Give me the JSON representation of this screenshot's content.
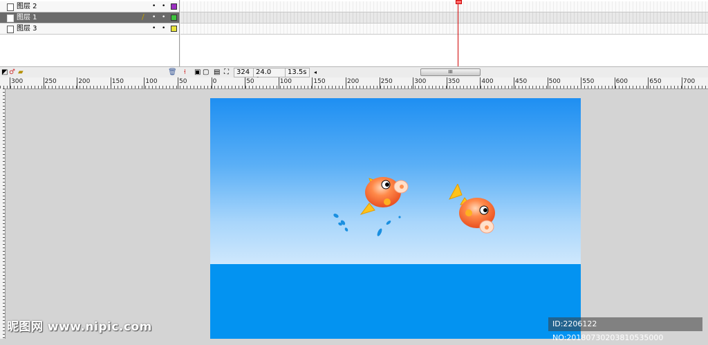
{
  "layers": [
    {
      "name": "图层 2",
      "color": "#9b2fc0",
      "selected": false
    },
    {
      "name": "图层 1",
      "color": "#3ec43e",
      "selected": true
    },
    {
      "name": "图层 3",
      "color": "#e8e43a",
      "selected": false
    }
  ],
  "timeline": {
    "frame": "324",
    "fps": "24.0 fps",
    "time": "13.5s",
    "scroll_grip": "III"
  },
  "ruler": {
    "labels": [
      "300",
      "250",
      "200",
      "150",
      "100",
      "50",
      "0",
      "50",
      "100",
      "150",
      "200",
      "250",
      "300",
      "350",
      "400",
      "450",
      "500",
      "550",
      "600",
      "650",
      "700"
    ]
  },
  "watermark": {
    "left": "昵图网 www.nipic.com",
    "right": "ID:2206122 NO:20180730203810535000"
  },
  "colors": {
    "sky_top": "#1e8ff2",
    "sky_bottom": "#cfe8fd",
    "sea": "#0393f1",
    "playhead": "#d00000"
  }
}
